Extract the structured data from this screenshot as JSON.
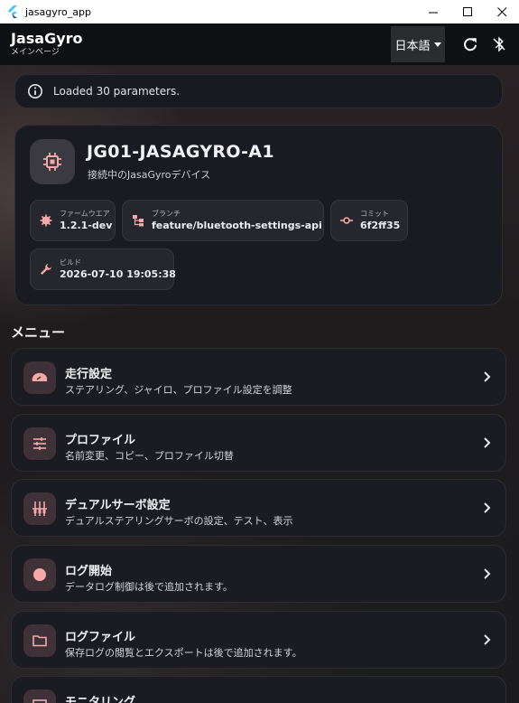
{
  "window": {
    "title": "jasagyro_app"
  },
  "app_bar": {
    "title": "JasaGyro",
    "subtitle": "メインページ",
    "language": "日本語"
  },
  "status": {
    "message": "Loaded 30 parameters."
  },
  "device": {
    "name": "JG01-JASAGYRO-A1",
    "subtitle": "接続中のJasaGyroデバイス",
    "chips": [
      {
        "label": "ファームウエア",
        "value": "1.2.1-dev",
        "icon": "firmware-icon"
      },
      {
        "label": "ブランチ",
        "value": "feature/bluetooth-settings-api",
        "icon": "branch-icon"
      },
      {
        "label": "コミット",
        "value": "6f2ff35",
        "icon": "commit-icon"
      },
      {
        "label": "ビルド",
        "value": "2026-07-10 19:05:38",
        "icon": "wrench-icon"
      }
    ]
  },
  "menu": {
    "heading": "メニュー",
    "items": [
      {
        "title": "走行設定",
        "subtitle": "ステアリング、ジャイロ、プロファイル設定を調整",
        "icon": "speedometer-icon"
      },
      {
        "title": "プロファイル",
        "subtitle": "名前変更、コピー、プロファイル切替",
        "icon": "sliders-icon"
      },
      {
        "title": "デュアルサーボ設定",
        "subtitle": "デュアルステアリングサーボの設定、テスト、表示",
        "icon": "servo-icon"
      },
      {
        "title": "ログ開始",
        "subtitle": "データログ制御は後で追加されます。",
        "icon": "record-icon"
      },
      {
        "title": "ログファイル",
        "subtitle": "保存ログの閲覧とエクスポートは後で追加されます。",
        "icon": "folder-icon"
      },
      {
        "title": "モニタリング",
        "subtitle": "",
        "icon": "monitor-icon"
      }
    ]
  },
  "colors": {
    "accent": "#f4a9a8",
    "icon_box": "#3e3238"
  }
}
